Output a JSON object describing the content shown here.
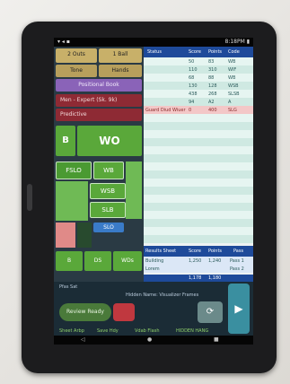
{
  "status_bar": {
    "left": "▾ ◂ ▪",
    "right": "8:18PM ▮"
  },
  "left_panel": {
    "top_buttons": [
      "2 Outs",
      "1 Ball"
    ],
    "row2_buttons": [
      "Tone",
      "Hands"
    ],
    "position_button": "Positional Book",
    "dropdown_1": "Men - Expert (Sk. 9k)",
    "dropdown_2": "Predictive",
    "big_buttons": {
      "wo": "WO",
      "b": "B"
    },
    "small_buttons": {
      "wb": "WB",
      "fslo": "FSLO",
      "wsb": "WSB",
      "slb": "SLB",
      "slo": "SLO"
    },
    "bottom_buttons": [
      "WDs",
      "DS",
      "B"
    ]
  },
  "table": {
    "headers": [
      "Status",
      "Score",
      "Points",
      "Code",
      ""
    ],
    "rows": [
      {
        "status": "",
        "score": "50",
        "points": "83",
        "code": "WB"
      },
      {
        "status": "",
        "score": "110",
        "points": "310",
        "code": "WIF"
      },
      {
        "status": "",
        "score": "68",
        "points": "88",
        "code": "WB"
      },
      {
        "status": "",
        "score": "130",
        "points": "128",
        "code": "WSB"
      },
      {
        "status": "",
        "score": "438",
        "points": "268",
        "code": "SLSB"
      },
      {
        "status": "",
        "score": "94",
        "points": "A2",
        "code": "A"
      },
      {
        "status": "Guard Diud Wiuer",
        "score": "0",
        "points": "400",
        "code": "SLG"
      }
    ],
    "results_headers": [
      "Results Sheet",
      "Score",
      "Points",
      "Pass"
    ],
    "results_rows": [
      {
        "label": "Building",
        "score": "1,250",
        "points": "1,240",
        "pass": "Pass 1"
      },
      {
        "label": "Lorem",
        "score": "",
        "points": "",
        "pass": "Pass 2"
      }
    ],
    "footer": {
      "score": "1,178",
      "points": "1,180"
    }
  },
  "bottom": {
    "note1": "Pfas Sat",
    "note2": "Hidden Name: Visualizer Frames",
    "review_label": "Review Ready",
    "refresh_icon": "⟳",
    "arrow_icon": "▶",
    "status_items": [
      "Sheet Arbp",
      "Save Hdy",
      "Vdab Flash",
      "HIDDEN HANG"
    ]
  },
  "nav_bar": {
    "back": "◁",
    "home": "●",
    "recent": "■"
  }
}
